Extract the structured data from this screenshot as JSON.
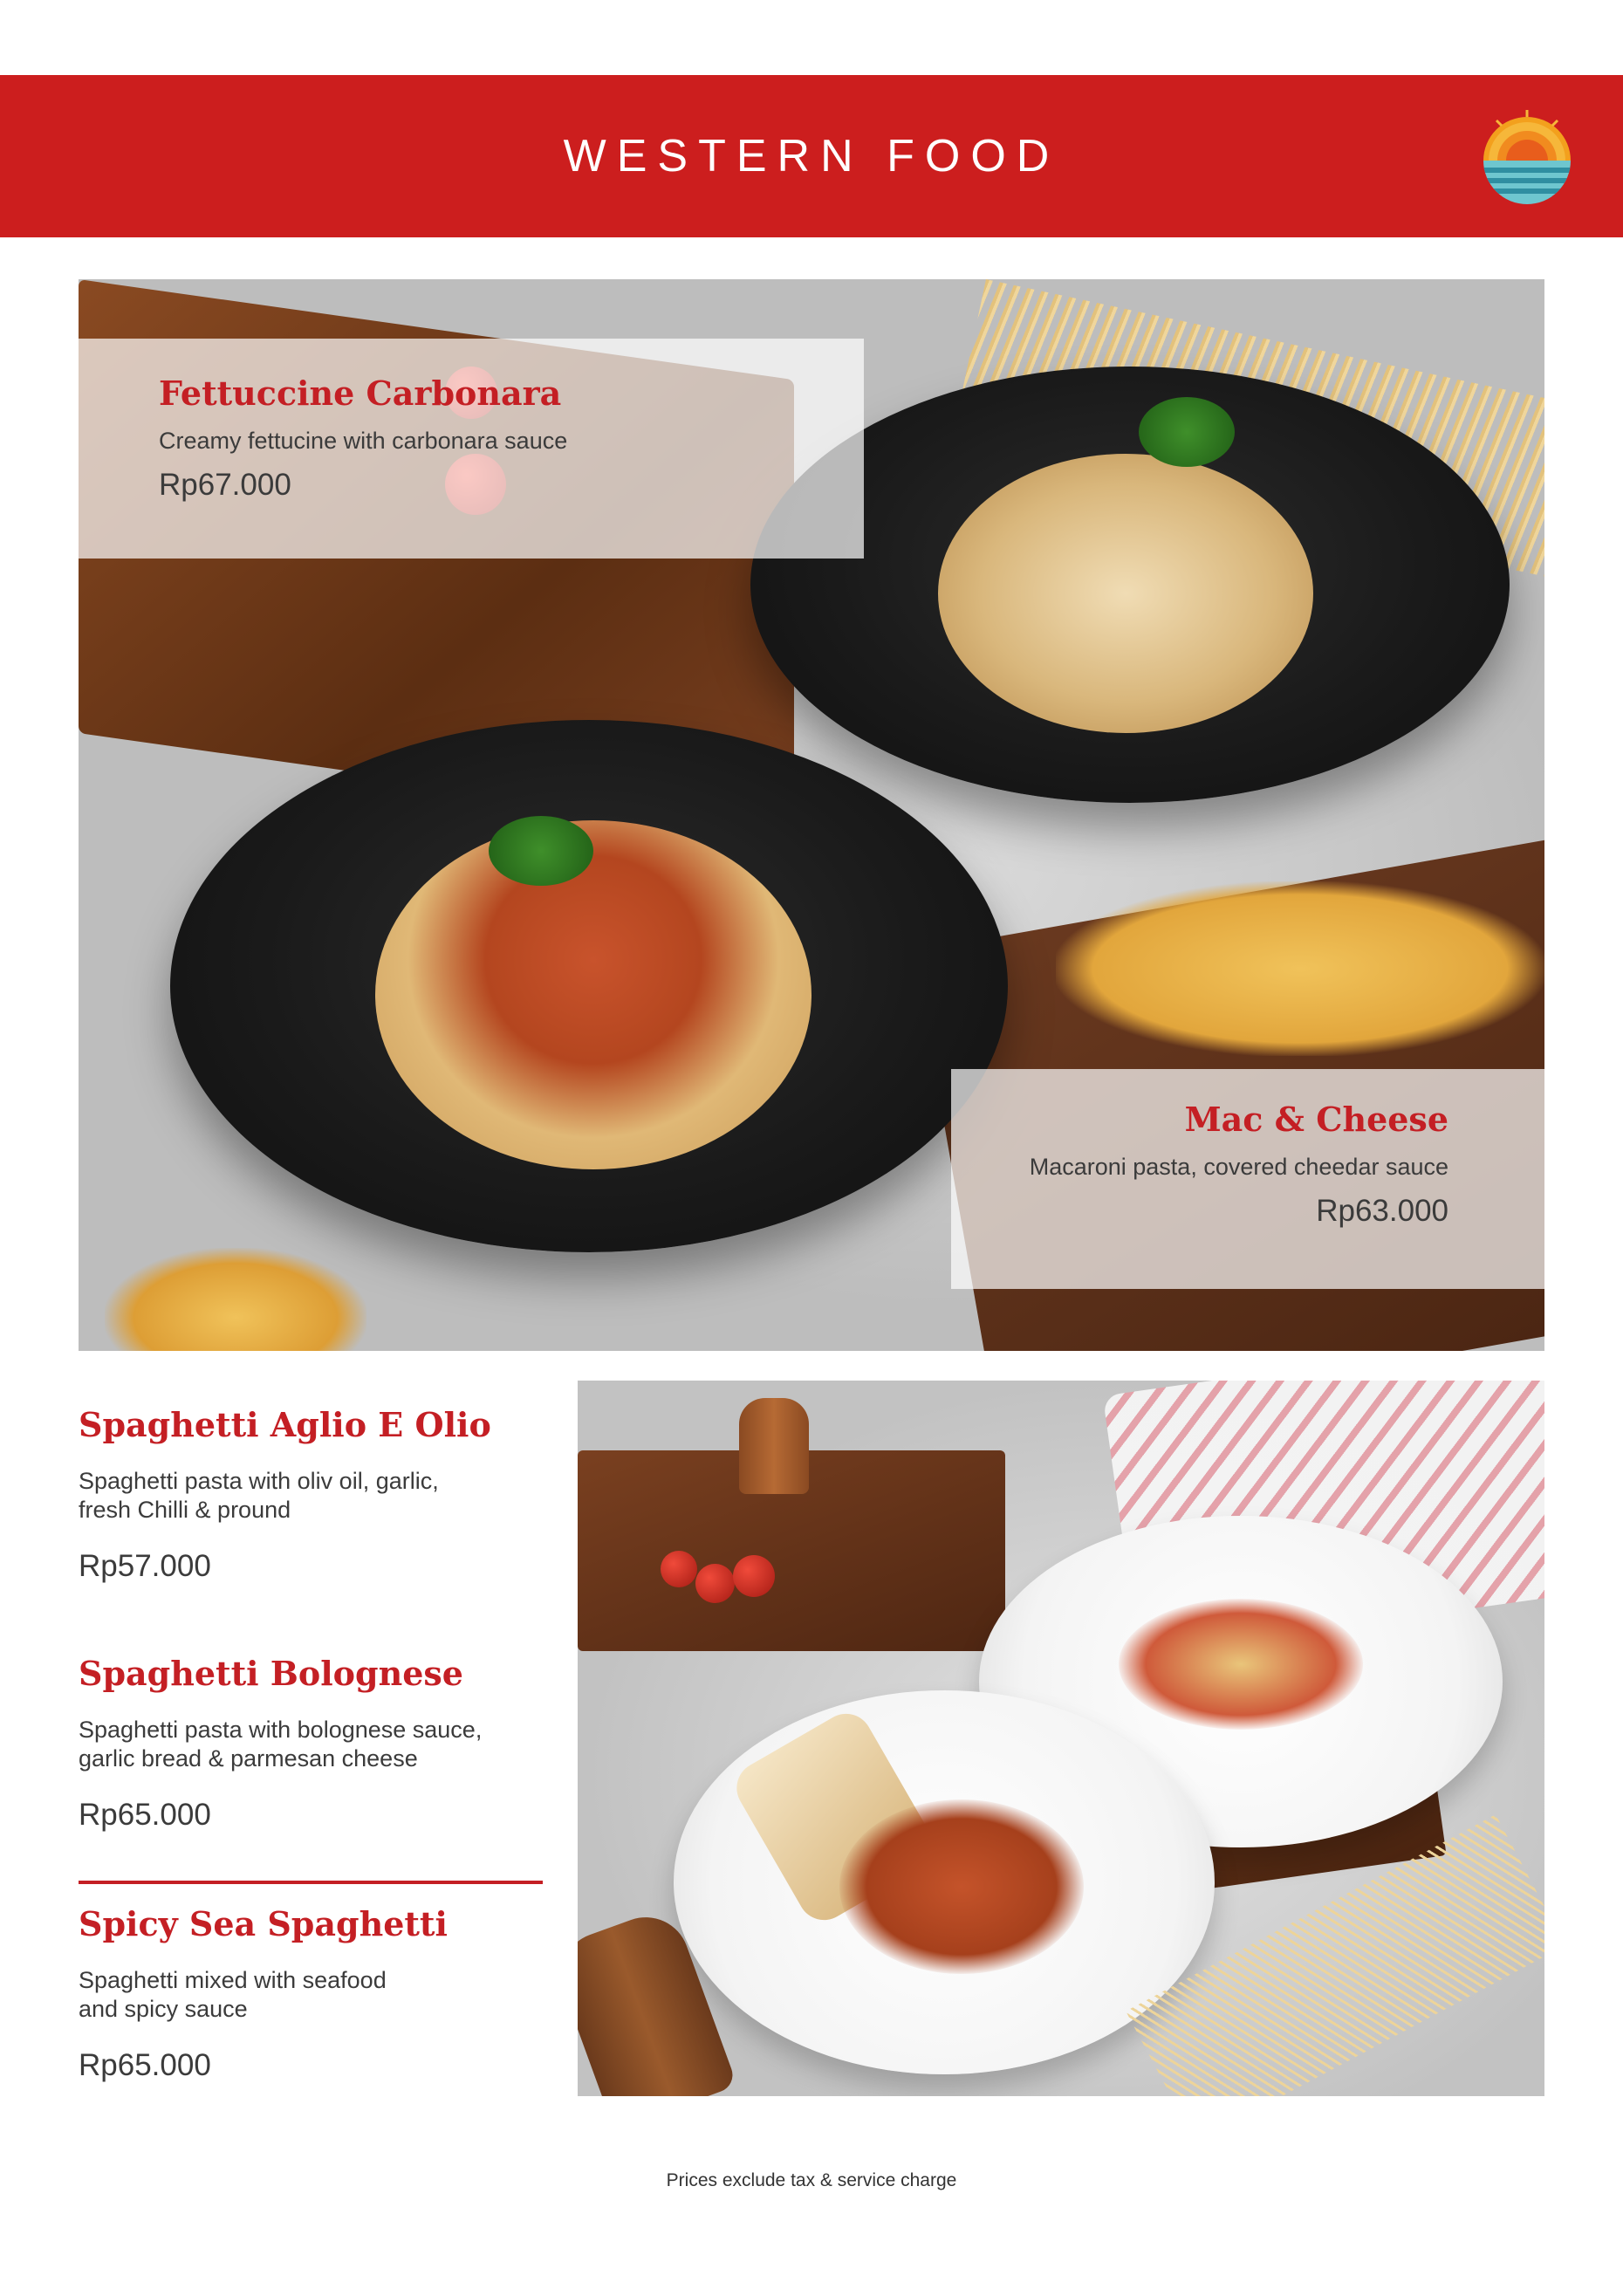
{
  "header": {
    "title": "WESTERN FOOD",
    "brand_color": "#cc1e1e",
    "logo_icon": "sun-over-sea-logo"
  },
  "hero_items": [
    {
      "name": "Fettuccine Carbonara",
      "description": "Creamy fettucine with carbonara sauce",
      "price": "Rp67.000"
    },
    {
      "name": "Mac & Cheese",
      "description": "Macaroni pasta, covered cheedar sauce",
      "price": "Rp63.000"
    }
  ],
  "list_items": [
    {
      "name": "Spaghetti Aglio E Olio",
      "description_line1": "Spaghetti pasta with oliv oil, garlic,",
      "description_line2": "fresh Chilli & pround",
      "price": "Rp57.000"
    },
    {
      "name": "Spaghetti Bolognese",
      "description_line1": "Spaghetti pasta with bolognese sauce,",
      "description_line2": "garlic bread & parmesan cheese",
      "price": "Rp65.000"
    },
    {
      "name": "Spicy Sea Spaghetti",
      "description_line1": "Spaghetti mixed with seafood",
      "description_line2": "and spicy sauce",
      "price": "Rp65.000"
    }
  ],
  "footer": {
    "note": "Prices exclude tax & service charge"
  },
  "colors": {
    "accent": "#c41f24",
    "text": "#3b3b3b"
  }
}
